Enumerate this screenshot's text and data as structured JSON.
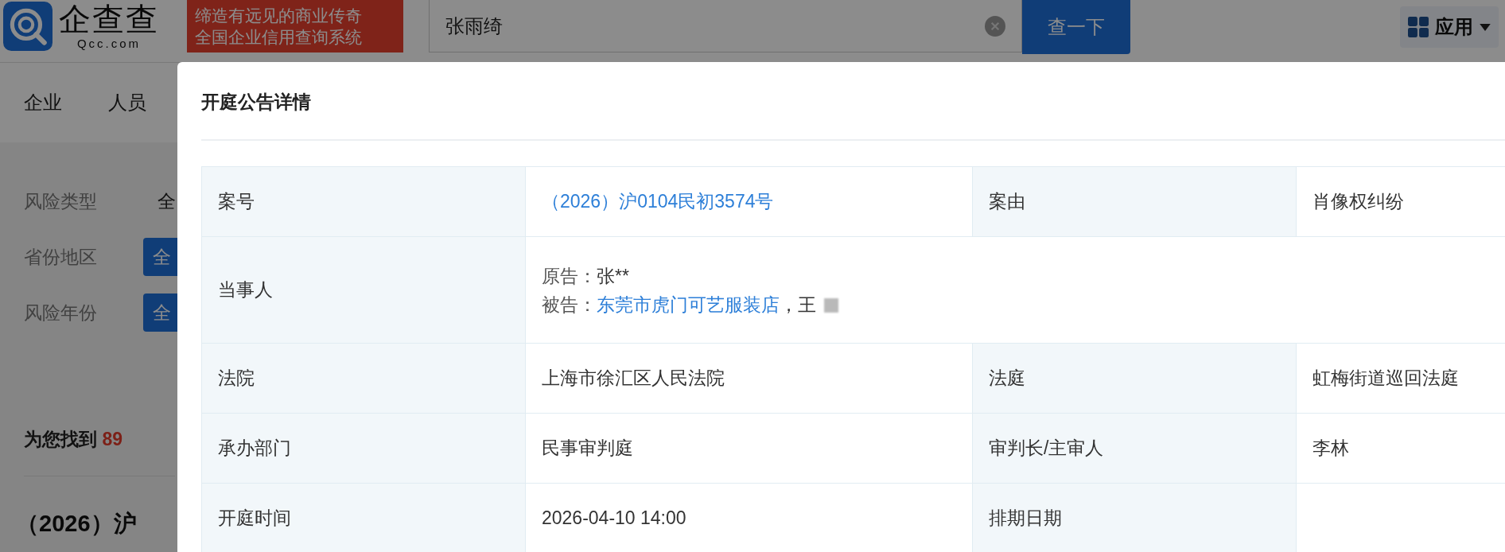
{
  "header": {
    "logo": {
      "name": "企查查",
      "domain": "Qcc.com"
    },
    "slogan": [
      "缔造有远见的商业传奇",
      "全国企业信用查询系统"
    ],
    "search": {
      "value": "张雨绮"
    },
    "search_button": "查一下",
    "apps_button": "应用"
  },
  "nav_tabs": [
    {
      "label": "企业"
    },
    {
      "label": "人员"
    }
  ],
  "filters": [
    {
      "label": "风险类型",
      "value": "全",
      "kind": "text"
    },
    {
      "label": "省份地区",
      "value": "全",
      "kind": "chip"
    },
    {
      "label": "风险年份",
      "value": "全",
      "kind": "chip"
    }
  ],
  "result_summary": {
    "prefix": "为您找到",
    "count": "89"
  },
  "result_title": "（2026）沪",
  "modal": {
    "title": "开庭公告详情",
    "rows": [
      {
        "cells": [
          {
            "kind": "label",
            "text": "案号"
          },
          {
            "kind": "link",
            "text": "（2026）沪0104民初3574号"
          },
          {
            "kind": "label",
            "text": "案由"
          },
          {
            "kind": "value",
            "text": "肖像权纠纷"
          }
        ]
      },
      {
        "cells": [
          {
            "kind": "label",
            "text": "当事人"
          },
          {
            "kind": "parties",
            "colspan": 3,
            "parties": [
              {
                "role": "原告：",
                "names": [
                  {
                    "kind": "value",
                    "text": "张**"
                  }
                ]
              },
              {
                "role": "被告：",
                "names": [
                  {
                    "kind": "link",
                    "text": "东莞市虎门可艺服装店"
                  },
                  {
                    "kind": "value",
                    "text": "，王"
                  },
                  {
                    "kind": "redacted"
                  }
                ]
              }
            ]
          }
        ]
      },
      {
        "cells": [
          {
            "kind": "label",
            "text": "法院"
          },
          {
            "kind": "value",
            "text": "上海市徐汇区人民法院"
          },
          {
            "kind": "label",
            "text": "法庭"
          },
          {
            "kind": "value",
            "text": "虹梅街道巡回法庭"
          }
        ]
      },
      {
        "cells": [
          {
            "kind": "label",
            "text": "承办部门"
          },
          {
            "kind": "value",
            "text": "民事审判庭"
          },
          {
            "kind": "label",
            "text": "审判长/主审人"
          },
          {
            "kind": "value",
            "text": "李林"
          }
        ]
      },
      {
        "cells": [
          {
            "kind": "label",
            "text": "开庭时间"
          },
          {
            "kind": "value",
            "text": "2026-04-10 14:00"
          },
          {
            "kind": "label",
            "text": "排期日期"
          },
          {
            "kind": "empty"
          }
        ]
      }
    ]
  }
}
